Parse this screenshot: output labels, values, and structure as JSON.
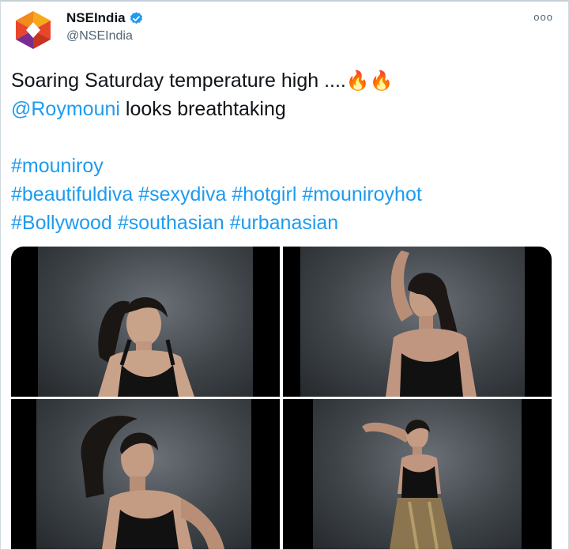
{
  "account": {
    "display_name": "NSEIndia",
    "handle": "@NSEIndia",
    "verified": true,
    "logo_colors": [
      "#e8462b",
      "#f7a81b",
      "#7a2d8f",
      "#ffffff"
    ]
  },
  "menu": {
    "more_label": "ooo"
  },
  "tweet": {
    "line1_text": "Soaring Saturday temperature high ....",
    "line1_emojis": "🔥🔥",
    "mention": "@Roymouni",
    "line2_text": " looks breathtaking",
    "hashtag_lines": [
      [
        "#mouniroy"
      ],
      [
        "#beautifuldiva",
        "#sexydiva",
        "#hotgirl",
        "#mouniroyhot"
      ],
      [
        "#Bollywood",
        "#southasian",
        "#urbanasian"
      ]
    ]
  },
  "media": {
    "photo_count": 4,
    "photos": [
      {
        "name": "photo-1",
        "description": "woman in black lace bodysuit, hair tossed"
      },
      {
        "name": "photo-2",
        "description": "woman with arm raised, black lace bodysuit"
      },
      {
        "name": "photo-3",
        "description": "woman with windswept hair, hand on hip"
      },
      {
        "name": "photo-4",
        "description": "woman in black top and gold skirt"
      }
    ]
  },
  "colors": {
    "link": "#1d9bf0",
    "text": "#0f1419",
    "secondary": "#536471",
    "verified_badge": "#1d9bf0"
  }
}
